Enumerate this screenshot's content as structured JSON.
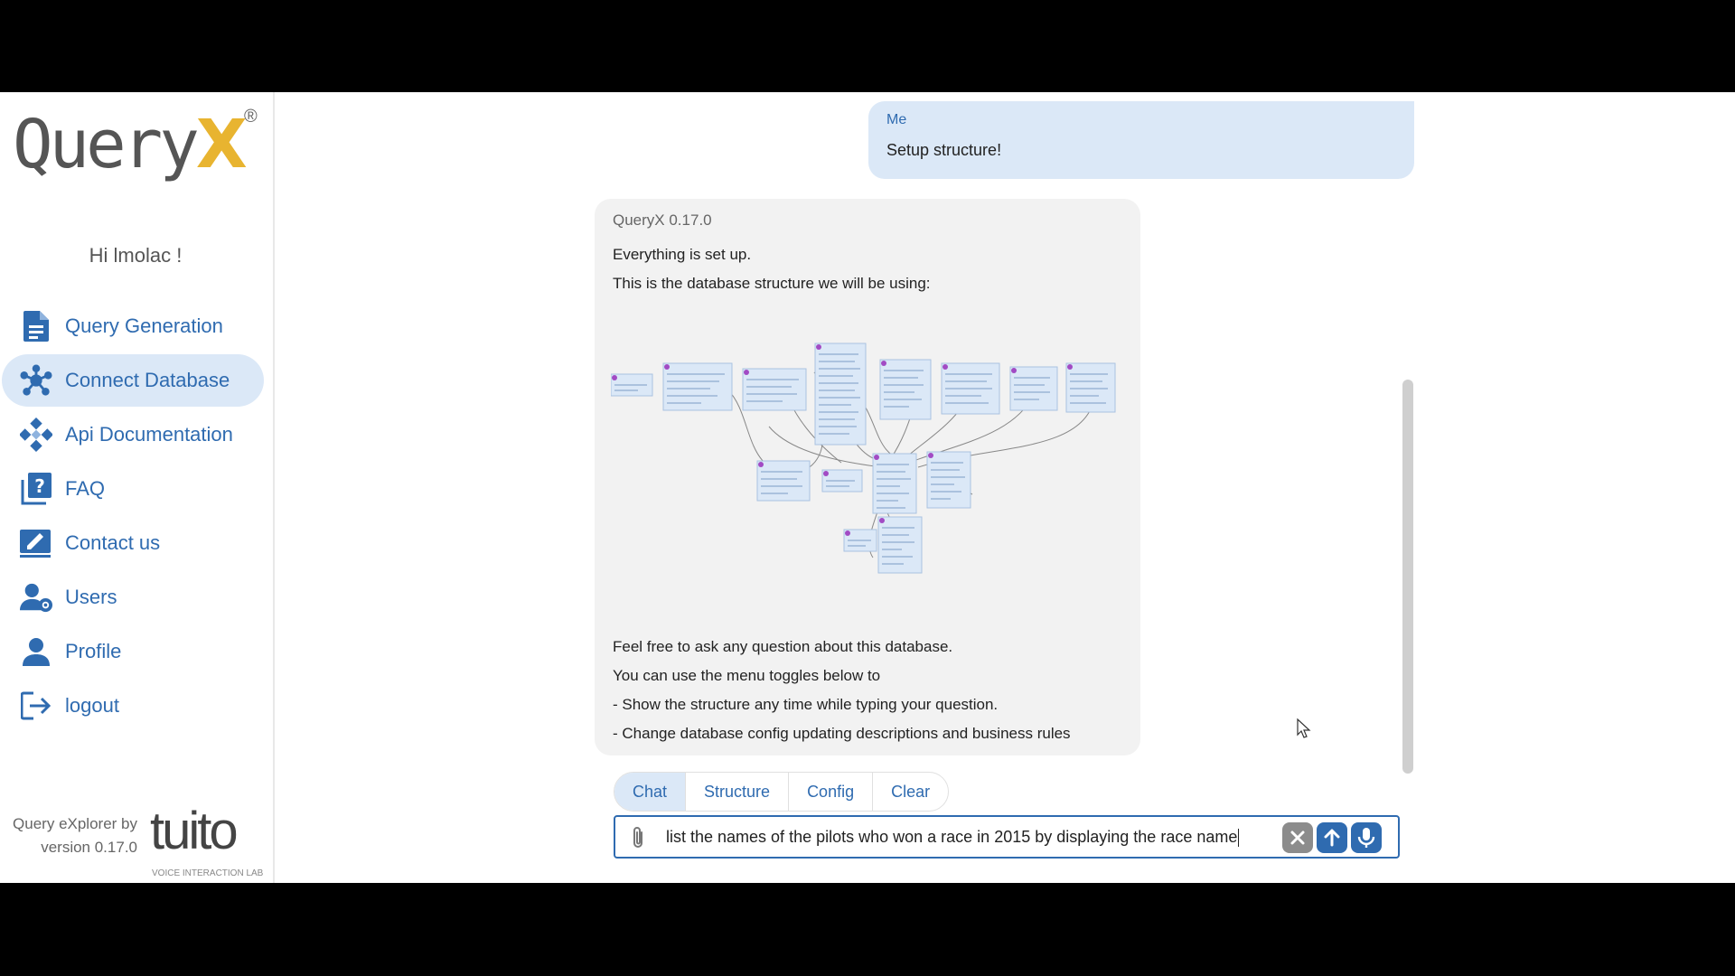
{
  "brand": {
    "logo_main": "Query",
    "logo_x": "X",
    "logo_reg": "®",
    "footer_line1": "Query eXplorer by",
    "footer_line2": "version 0.17.0",
    "partner": "tuito",
    "partner_sub": "VOICE INTERACTION LAB"
  },
  "sidebar": {
    "greeting": "Hi lmolac !",
    "items": [
      {
        "label": "Query Generation",
        "icon": "document-icon"
      },
      {
        "label": "Connect Database",
        "icon": "network-icon",
        "active": true
      },
      {
        "label": "Api Documentation",
        "icon": "api-icon"
      },
      {
        "label": "FAQ",
        "icon": "faq-icon"
      },
      {
        "label": "Contact us",
        "icon": "edit-icon"
      },
      {
        "label": "Users",
        "icon": "users-gear-icon"
      },
      {
        "label": "Profile",
        "icon": "person-icon"
      },
      {
        "label": "logout",
        "icon": "logout-icon"
      }
    ]
  },
  "chat": {
    "user_message": {
      "author": "Me",
      "text": "Setup structure!"
    },
    "bot_message": {
      "author": "QueryX 0.17.0",
      "line1": "Everything is set up.",
      "line2": "This is the database structure we will be using:",
      "line3": "Feel free to ask any question about this database.",
      "line4": "You can use the menu toggles below to",
      "line5": "- Show the structure any time while typing your question.",
      "line6": "- Change database config updating descriptions and business rules"
    }
  },
  "toolbar": {
    "tabs": [
      "Chat",
      "Structure",
      "Config",
      "Clear"
    ],
    "active_tab": "Chat"
  },
  "input": {
    "value": "list the names of the pilots who won a race in 2015 by displaying the race name"
  },
  "colors": {
    "accent": "#2f6bb0",
    "active_bg": "#dbe8f7",
    "logo_yellow": "#e8b430"
  }
}
